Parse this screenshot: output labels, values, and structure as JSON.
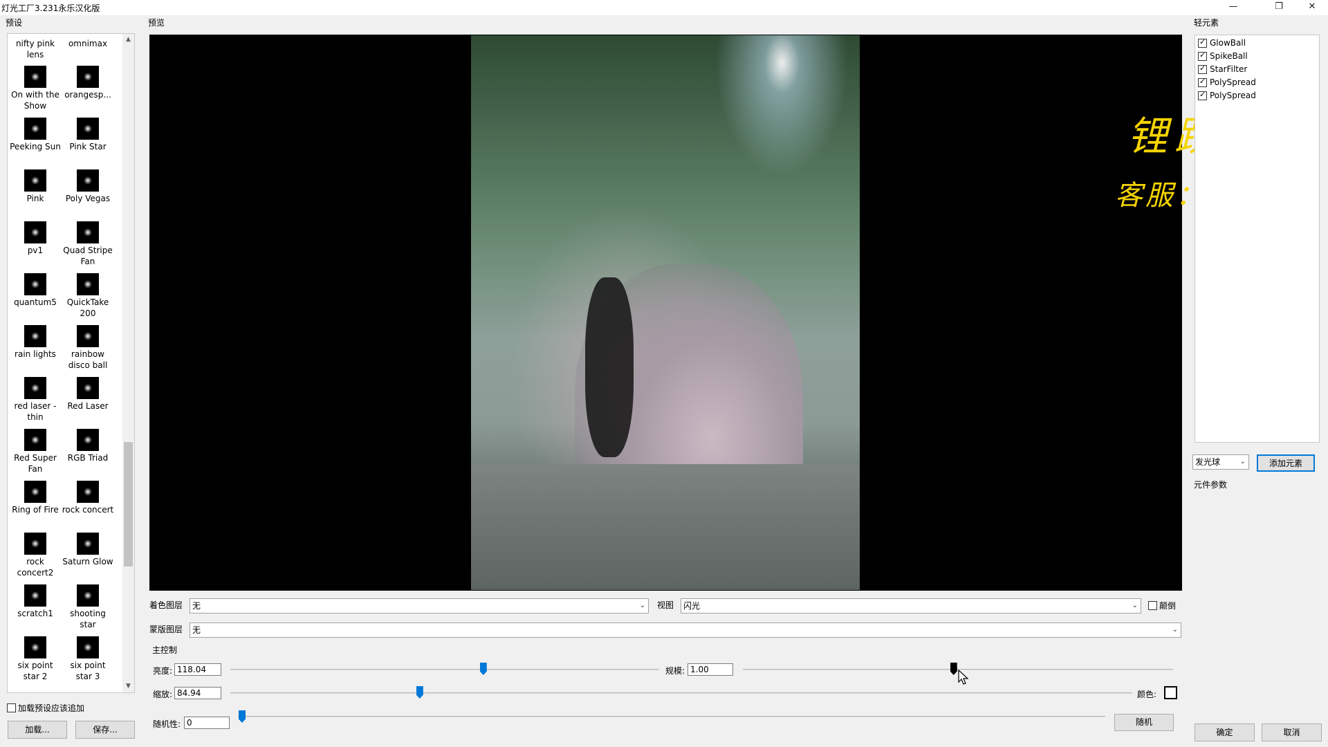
{
  "window": {
    "title": "灯光工厂3.231永乐汉化版",
    "minimize": "—",
    "restore": "❐",
    "close": "✕"
  },
  "presets": {
    "label": "预设",
    "items": [
      {
        "name": "nifty pink lens"
      },
      {
        "name": "omnimax"
      },
      {
        "name": "On with the Show"
      },
      {
        "name": "orangesp..."
      },
      {
        "name": "Peeking Sun"
      },
      {
        "name": "Pink Star"
      },
      {
        "name": "Pink"
      },
      {
        "name": "Poly Vegas"
      },
      {
        "name": "pv1"
      },
      {
        "name": "Quad Stripe Fan"
      },
      {
        "name": "quantum5"
      },
      {
        "name": "QuickTake 200"
      },
      {
        "name": "rain lights"
      },
      {
        "name": "rainbow disco ball"
      },
      {
        "name": "red laser - thin"
      },
      {
        "name": "Red Laser"
      },
      {
        "name": "Red Super Fan"
      },
      {
        "name": "RGB Triad"
      },
      {
        "name": "Ring of Fire"
      },
      {
        "name": "rock concert"
      },
      {
        "name": "rock concert2"
      },
      {
        "name": "Saturn Glow"
      },
      {
        "name": "scratch1"
      },
      {
        "name": "shooting star"
      },
      {
        "name": "six point star 2"
      },
      {
        "name": "six point star 3"
      }
    ],
    "append_label": "加载预设应该追加",
    "load_button": "加载...",
    "save_button": "保存...",
    "scroll_up": "▲",
    "scroll_down": "▼"
  },
  "preview": {
    "label": "预览",
    "watermark_line1": "锂跃宝",
    "watermark_line2": "客服：Abbey"
  },
  "layers": {
    "color_layer_label": "着色图层",
    "color_layer_value": "无",
    "view_label": "视图",
    "view_value": "闪光",
    "invert_label": "颠倒",
    "mask_layer_label": "蒙版图层",
    "mask_layer_value": "无",
    "dropdown_arrow": "⌄"
  },
  "main_controls": {
    "label": "主控制",
    "brightness_label": "亮度:",
    "brightness_value": "118.04",
    "brightness_level": 0.59,
    "scale_label": "规模:",
    "scale_value": "1.00",
    "scale_level": 0.49,
    "zoom_label": "缩放:",
    "zoom_value": "84.94",
    "zoom_level": 0.21,
    "color_label": "颜色:",
    "random_label": "随机性:",
    "random_value": "0",
    "random_level": 0.0,
    "random_button": "随机"
  },
  "light_elements": {
    "label": "轻元素",
    "items": [
      {
        "name": "GlowBall",
        "checked": true
      },
      {
        "name": "SpikeBall",
        "checked": true
      },
      {
        "name": "StarFilter",
        "checked": true
      },
      {
        "name": "PolySpread",
        "checked": true
      },
      {
        "name": "PolySpread",
        "checked": true
      }
    ],
    "type_value": "发光球",
    "add_button": "添加元素",
    "params_label": "元件参数"
  },
  "footer": {
    "ok_button": "确定",
    "cancel_button": "取消"
  }
}
